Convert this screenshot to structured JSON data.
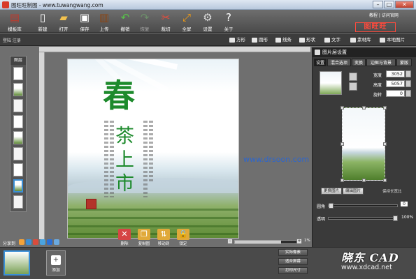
{
  "window": {
    "title": "图旺旺制图 - www.tuwangwang.com",
    "min": "–",
    "max": "□",
    "close": "✕"
  },
  "toolbar": {
    "items": [
      {
        "label": "模板库",
        "icon": "template-library-icon",
        "glyph": "▤",
        "color": "#c0392b"
      },
      {
        "label": "新建",
        "icon": "new-file-icon",
        "glyph": "▯",
        "color": "#ffffff"
      },
      {
        "label": "打开",
        "icon": "open-folder-icon",
        "glyph": "▰",
        "color": "#f2c14e"
      },
      {
        "label": "保存",
        "icon": "save-icon",
        "glyph": "▣",
        "color": "#ffffff"
      },
      {
        "label": "上传",
        "icon": "upload-icon",
        "glyph": "▥",
        "color": "#8b4513"
      },
      {
        "label": "撤销",
        "icon": "undo-icon",
        "glyph": "↶",
        "color": "#58c24a"
      },
      {
        "label": "恢复",
        "icon": "redo-icon",
        "glyph": "↷",
        "color": "#6d8f6a"
      },
      {
        "label": "裁切",
        "icon": "crop-scissors-icon",
        "glyph": "✂",
        "color": "#e74c3c"
      },
      {
        "label": "全屏",
        "icon": "fullscreen-icon",
        "glyph": "⤢",
        "color": "#f39c12"
      },
      {
        "label": "设置",
        "icon": "settings-gear-icon",
        "glyph": "⚙",
        "color": "#dddddd"
      },
      {
        "label": "关于",
        "icon": "help-question-icon",
        "glyph": "?",
        "color": "#ffffff"
      }
    ],
    "links": "教程 | 访问官网",
    "brand": "图旺旺"
  },
  "toolbar2": {
    "breadcrumb": "登陆 注册",
    "buttons": [
      {
        "label": "方形",
        "icon": "rectangle-icon"
      },
      {
        "label": "圆形",
        "icon": "circle-icon"
      },
      {
        "label": "线条",
        "icon": "line-icon"
      },
      {
        "label": "形状",
        "icon": "shape-icon"
      },
      {
        "label": "文字",
        "icon": "text-icon"
      },
      {
        "label": "素材库",
        "icon": "material-library-icon"
      },
      {
        "label": "本地图片",
        "icon": "local-image-icon"
      }
    ]
  },
  "layers": {
    "title": "图层",
    "count": 9,
    "selected_index": 7
  },
  "canvas": {
    "headline_char": "春",
    "sub_chars": "茶上市",
    "watermark": "www.drsoon.com"
  },
  "actions": [
    {
      "label": "删除",
      "icon": "delete-x-icon",
      "color": "#d64545",
      "glyph": "✕"
    },
    {
      "label": "复制图",
      "icon": "copy-icon",
      "color": "#e0a93a",
      "glyph": "❐"
    },
    {
      "label": "移动到",
      "icon": "move-icon",
      "color": "#e0a93a",
      "glyph": "⇅"
    },
    {
      "label": "锁定",
      "icon": "lock-icon",
      "color": "#e0a93a",
      "glyph": "🔒"
    }
  ],
  "zoom": {
    "value": 0.7,
    "label": "1%"
  },
  "share": {
    "label": "分享到"
  },
  "pages": {
    "add_label": "添加"
  },
  "side_buttons": [
    "实际像素",
    "适合屏幕",
    "打印尺寸"
  ],
  "right_panel": {
    "title": "图片层设置",
    "tabs": [
      "设置",
      "混合选项",
      "变换",
      "边框与背景",
      "蒙版"
    ],
    "width_label": "宽度",
    "width_value": "3052",
    "height_label": "高度",
    "height_value": "5057",
    "rotate_label": "旋转",
    "rotate_value": "0",
    "replace_btn": "更换图片",
    "edit_btn": "编辑图片",
    "keep_ratio": "保持长宽比",
    "radius_label": "圆角",
    "radius_value": "0",
    "opacity_label": "透明",
    "opacity_value": "100%",
    "opacity_level": 1.0
  },
  "footer_watermark": {
    "logo": "晓东 CAD",
    "url": "www.xdcad.net"
  }
}
